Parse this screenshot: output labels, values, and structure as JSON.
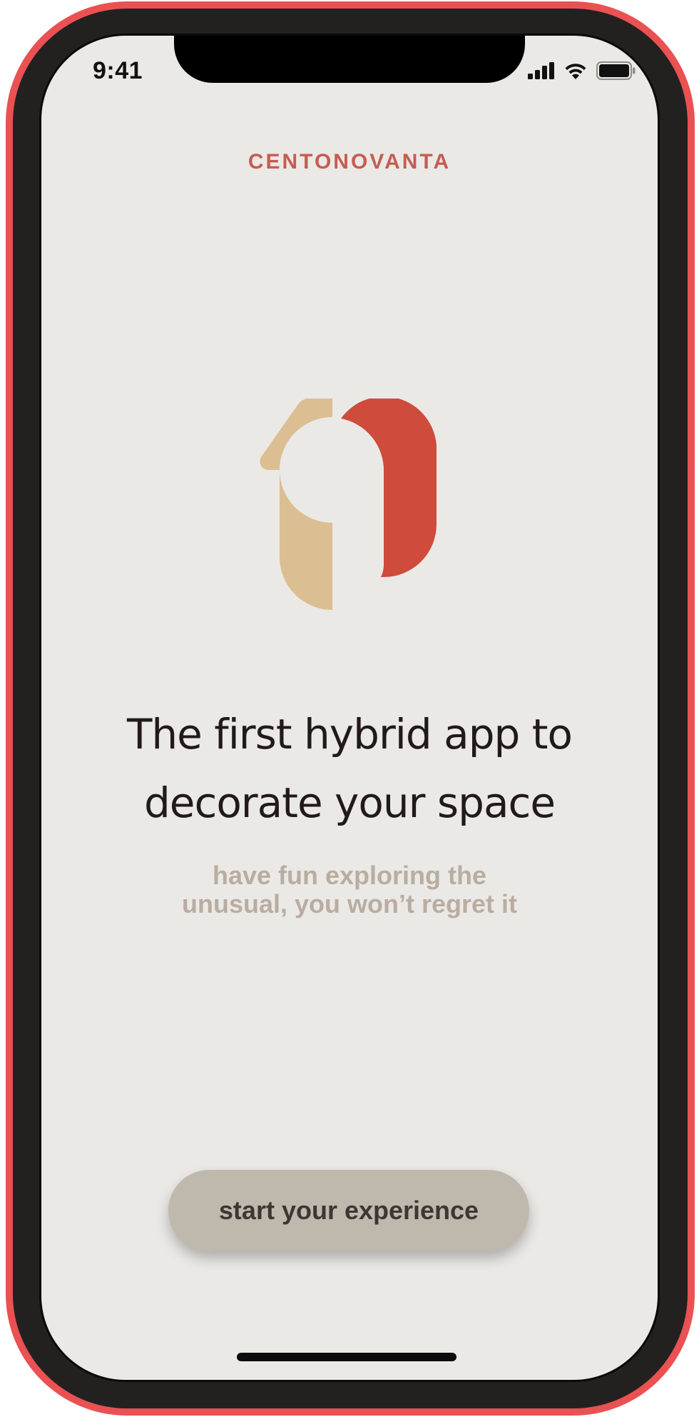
{
  "status_bar": {
    "time": "9:41",
    "icons": [
      "cellular-signal-icon",
      "wifi-icon",
      "battery-icon"
    ]
  },
  "brand": {
    "name": "CENTONOVANTA"
  },
  "logo": {
    "icon": "centonovanta-logo-icon",
    "colors": {
      "left_shape": "#dbbe92",
      "right_shape": "#cf4b3c"
    }
  },
  "hero": {
    "headline_line1": "The first hybrid app to",
    "headline_line2": "decorate your space",
    "sub_line1": "have fun exploring the",
    "sub_line2": "unusual, you won’t regret it"
  },
  "cta": {
    "label": "start your experience"
  },
  "colors": {
    "frame": "#ea5152",
    "screen_bg": "#ebe9e6",
    "brand": "#c65c53",
    "headline": "#22191a",
    "subline": "#b9ada1",
    "button_bg": "#bfb8ad",
    "button_text": "#3c3734"
  }
}
